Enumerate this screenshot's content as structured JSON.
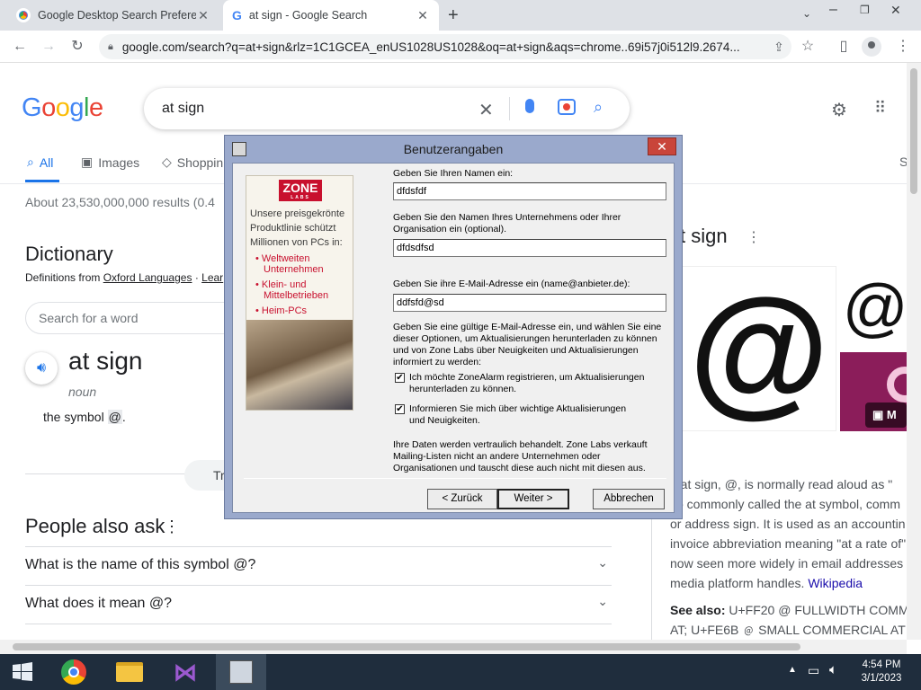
{
  "browser": {
    "tabs": [
      {
        "title": "Google Desktop Search Preferen",
        "close": "✕"
      },
      {
        "title": "at sign - Google Search",
        "close": "✕"
      }
    ],
    "new_tab": "+",
    "url": "google.com/search?q=at+sign&rlz=1C1GCEA_enUS1028US1028&oq=at+sign&aqs=chrome..69i57j0i512l9.2674..."
  },
  "google": {
    "logo": "Google",
    "query": "at sign",
    "nav_tabs": [
      {
        "label": "All",
        "icon": "search-icon"
      },
      {
        "label": "Images",
        "icon": "image-icon"
      },
      {
        "label": "Shoppin",
        "icon": "tag-icon"
      },
      {
        "label": "S"
      }
    ],
    "result_stats": "About 23,530,000,000 results (0.4",
    "dictionary": {
      "heading": "Dictionary",
      "source_prefix": "Definitions from",
      "source_link": "Oxford Languages",
      "learn": "Lear",
      "word_search_placeholder": "Search for a word",
      "word": "at sign",
      "pos": "noun",
      "definition_prefix": "the symbol",
      "definition_symbol": "@",
      "translate_btn": "Tr"
    },
    "people_also_ask": {
      "heading": "People also ask",
      "questions": [
        "What is the name of this symbol @?",
        "What does it mean @?"
      ]
    },
    "knowledge_panel": {
      "title": "t sign",
      "big_symbol": "@",
      "image_label": "M",
      "text": [
        "e at sign, @, is normally read aloud as \"",
        "so commonly called the at symbol, comm",
        "or address sign. It is used as an accountin",
        "invoice abbreviation meaning \"at a rate of\"",
        "now seen more widely in email addresses",
        "media platform handles."
      ],
      "wiki": "Wikipedia",
      "see_also_label": "See also:",
      "see_also_1": "U+FF20 @ FULLWIDTH COMM",
      "see_also_2": "AT; U+FE6B ﹫ SMALL COMMERCIAL AT"
    }
  },
  "dialog": {
    "title": "Benutzerangaben",
    "close": "✕",
    "banner": {
      "logo_top": "ZONE",
      "logo_bottom": "LABS",
      "tagline_1": "Unsere preisgekrönte",
      "tagline_2": "Produktlinie schützt",
      "tagline_3": "Millionen von PCs in:",
      "bullet_1a": "Weltweiten",
      "bullet_1b": "Unternehmen",
      "bullet_2a": "Klein- und",
      "bullet_2b": "Mittelbetrieben",
      "bullet_3": "Heim-PCs"
    },
    "name_label": "Geben Sie Ihren Namen ein:",
    "name_value": "dfdsfdf",
    "org_label_1": "Geben Sie den Namen Ihres Unternehmens oder Ihrer",
    "org_label_2": "Organisation ein (optional).",
    "org_value": "dfdsdfsd",
    "email_label": "Geben Sie ihre E-Mail-Adresse ein (name@anbieter.de):",
    "email_value": "ddfsfd@sd",
    "info_1": "Geben Sie eine gültige E-Mail-Adresse ein, und wählen Sie eine",
    "info_2": "dieser Optionen, um Aktualisierungen herunterladen zu können",
    "info_3": "und von Zone Labs über Neuigkeiten und Aktualisierungen",
    "info_4": "informiert zu werden:",
    "check1_1": "Ich möchte ZoneAlarm registrieren, um Aktualisierungen",
    "check1_2": "herunterladen zu können.",
    "check2_1": "Informieren Sie mich über wichtige Aktualisierungen",
    "check2_2": "und Neuigkeiten.",
    "checkmark": "✔",
    "privacy_1": "Ihre Daten werden vertraulich behandelt. Zone Labs verkauft",
    "privacy_2": "Mailing-Listen nicht an andere Unternehmen oder",
    "privacy_3": "Organisationen und tauscht diese auch nicht mit diesen aus.",
    "back_btn": "< Zurück",
    "next_btn": "Weiter >",
    "cancel_btn": "Abbrechen"
  },
  "taskbar": {
    "time": "4:54 PM",
    "date": "3/1/2023"
  }
}
